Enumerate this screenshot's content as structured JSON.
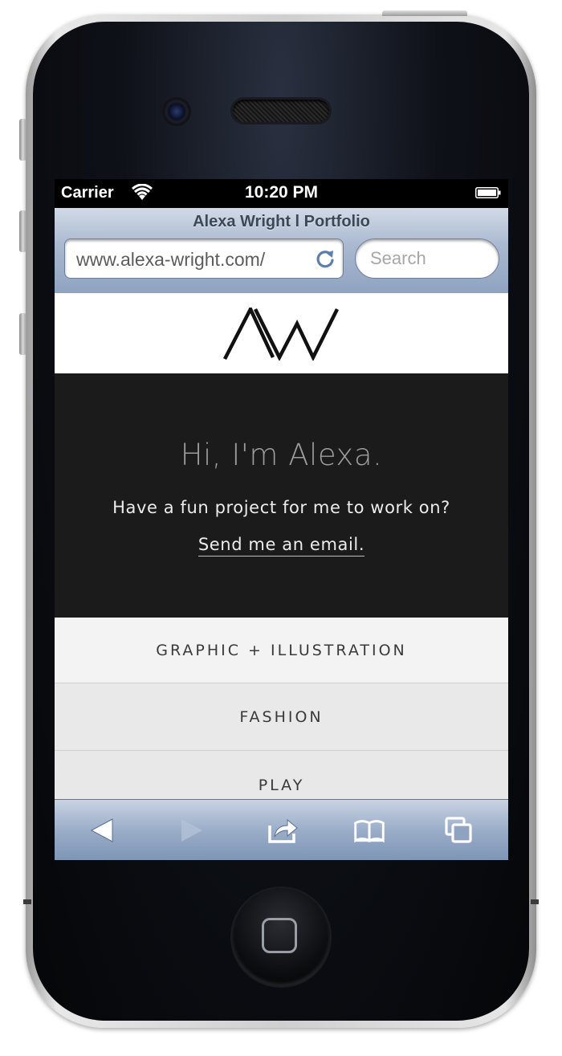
{
  "status_bar": {
    "carrier": "Carrier",
    "time": "10:20 PM"
  },
  "browser": {
    "page_title": "Alexa Wright l Portfolio",
    "url": "www.alexa-wright.com/",
    "search_placeholder": "Search"
  },
  "site": {
    "logo_text": "AW",
    "hero": {
      "greeting": "Hi, I'm Alexa.",
      "body_prefix": "Have a fun project for me to work on?",
      "email_link": "Send me an email."
    },
    "nav": [
      {
        "label": "GRAPHIC + ILLUSTRATION"
      },
      {
        "label": "FASHION"
      },
      {
        "label": "PLAY"
      }
    ]
  },
  "toolbar": {
    "icons": [
      "back-icon",
      "forward-icon",
      "share-icon",
      "bookmarks-icon",
      "tabs-icon"
    ]
  },
  "colors": {
    "hero_background": "#1b1b1b",
    "safari_chrome": "#9aadc8"
  }
}
